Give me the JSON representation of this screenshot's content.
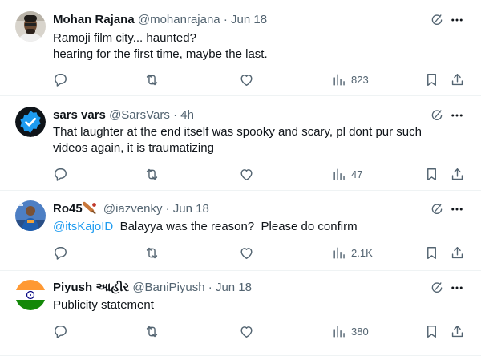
{
  "tweets": [
    {
      "name": "Mohan Rajana",
      "handle": "@mohanrajana",
      "date": "Jun 18",
      "text_line1": "Ramoji film city... haunted?",
      "text_line2": "hearing for the first time, maybe the last.",
      "views": "823"
    },
    {
      "name": "sars vars",
      "handle": "@SarsVars",
      "date": "4h",
      "text_line1": "That laughter at the end itself was spooky and scary, pl dont pur such",
      "text_line2": "videos again, it is traumatizing",
      "views": "47"
    },
    {
      "name": "Ro45",
      "handle": "@iazvenky",
      "date": "Jun 18",
      "mention": "@itsKajoID",
      "text_line1": "  Balayya was the reason?  Please do confirm",
      "views": "2.1K"
    },
    {
      "name": "Piyush આહીર",
      "handle": "@BaniPiyush",
      "date": "Jun 18",
      "text_line1": "Publicity statement",
      "views": "380"
    }
  ],
  "separator": "·",
  "icons": {
    "reply": "reply-icon",
    "retweet": "retweet-icon",
    "like": "like-icon",
    "views": "views-icon",
    "bookmark": "bookmark-icon",
    "share": "share-icon",
    "grok": "grok-icon",
    "more": "more-icon",
    "verified": "verified-badge-icon",
    "cricket": "cricket-bat-emoji"
  },
  "colors": {
    "text": "#0f1419",
    "secondary": "#536471",
    "link": "#1d9bf0",
    "verified": "#1d9bf0",
    "divider": "#eff3f4"
  }
}
